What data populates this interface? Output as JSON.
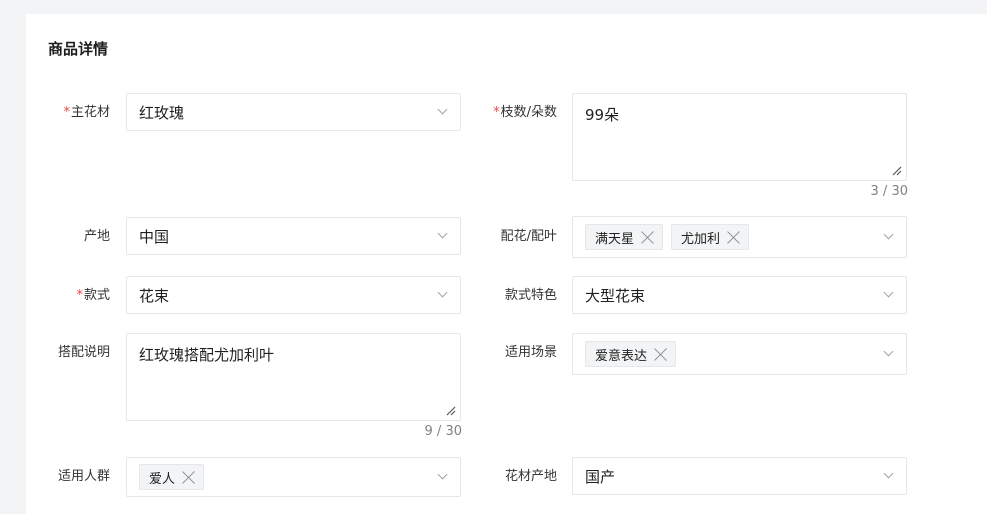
{
  "section": {
    "title": "商品详情"
  },
  "fields": {
    "main_flower": {
      "label": "主花材",
      "required": true,
      "value": "红玫瑰"
    },
    "count": {
      "label": "枝数/朵数",
      "required": true,
      "value": "99朵",
      "counter": "3 / 30"
    },
    "origin": {
      "label": "产地",
      "value": "中国"
    },
    "accessories": {
      "label": "配花/配叶",
      "tags": [
        "满天星",
        "尤加利"
      ]
    },
    "style": {
      "label": "款式",
      "required": true,
      "value": "花束"
    },
    "style_feature": {
      "label": "款式特色",
      "value": "大型花束"
    },
    "match_desc": {
      "label": "搭配说明",
      "value": "红玫瑰搭配尤加利叶",
      "counter": "9 / 30"
    },
    "occasion": {
      "label": "适用场景",
      "tags": [
        "爱意表达"
      ]
    },
    "audience": {
      "label": "适用人群",
      "tags": [
        "爱人"
      ]
    },
    "material_origin": {
      "label": "花材产地",
      "value": "国产"
    }
  },
  "required_mark": "*",
  "icons": {
    "dropdown": "chevron-down-icon",
    "remove": "close-icon",
    "resize": "resize-handle-icon"
  },
  "colors": {
    "required": "#ef4444",
    "border": "#e5e7eb",
    "tag_bg": "#f3f4f6"
  }
}
